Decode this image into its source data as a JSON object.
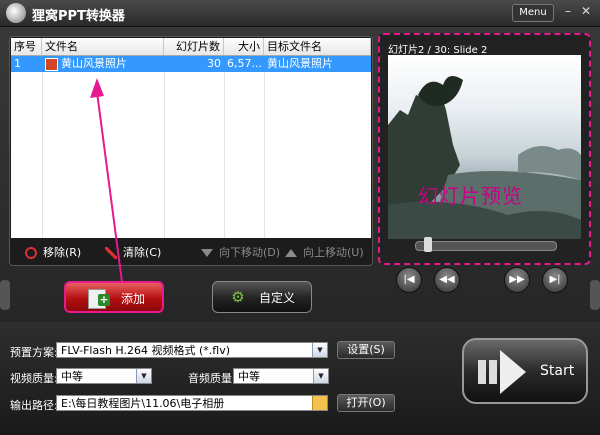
{
  "app": {
    "title": "狸窝PPT转换器",
    "menu_label": "Menu",
    "minimize_icon": "minimize-icon",
    "close_icon": "close-icon"
  },
  "file_table": {
    "columns": [
      "序号",
      "文件名",
      "幻灯片数",
      "大小",
      "目标文件名"
    ],
    "rows": [
      {
        "index": "1",
        "filename": "黄山风景照片",
        "slides": "30",
        "size": "6,57...",
        "target": "黄山风景照片"
      }
    ]
  },
  "toolbar": {
    "remove_label": "移除(R)",
    "clear_label": "清除(C)",
    "move_down_label": "向下移动(D)",
    "move_up_label": "向上移动(U)"
  },
  "preview": {
    "header": "幻灯片2 / 30: Slide 2",
    "overlay_text": "幻灯片预览"
  },
  "buttons": {
    "add_label": "添加(A)",
    "custom_label": "自定义(E)",
    "settings_label": "设置(S)",
    "open_label": "打开(O)",
    "start_label": "Start"
  },
  "settings": {
    "preset_label": "预置方案:",
    "preset_value": "FLV-Flash H.264 视频格式 (*.flv)",
    "video_quality_label": "视频质量:",
    "video_quality_value": "中等",
    "audio_quality_label": "音频质量:",
    "audio_quality_value": "中等",
    "output_label": "输出路径:",
    "output_value": "E:\\每日教程图片\\11.06\\电子相册"
  },
  "colors": {
    "selection": "#3399ff",
    "annotation": "#e8188f",
    "add_button": "#b61010"
  }
}
